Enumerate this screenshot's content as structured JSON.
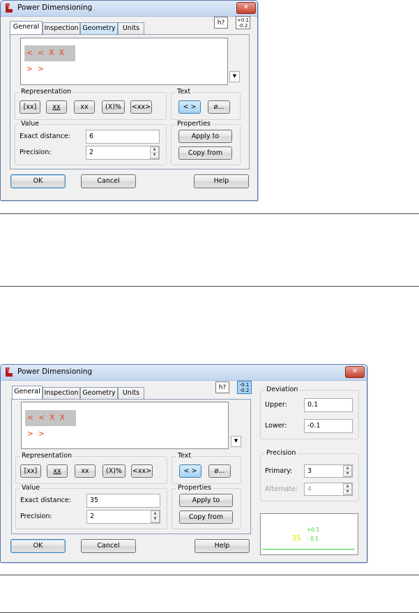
{
  "dialog_top": {
    "title": "Power Dimensioning",
    "close_glyph": "✕",
    "tabs": [
      {
        "label": "General",
        "state": "active"
      },
      {
        "label": "Inspection",
        "state": "normal"
      },
      {
        "label": "Geometry",
        "state": "hover"
      },
      {
        "label": "Units",
        "state": "normal"
      }
    ],
    "h_icon": "h?",
    "tol_icon_top": "+0.1",
    "tol_icon_bottom": "-0.2",
    "dimension_text": "< < X X > >",
    "representation": {
      "label": "Representation",
      "buttons": [
        "[xx]",
        "xx",
        "xx",
        "(X)%",
        "<xx>"
      ]
    },
    "text_group": {
      "label": "Text",
      "buttons": [
        "< >",
        "ø..."
      ]
    },
    "value": {
      "label": "Value",
      "exact_label": "Exact distance:",
      "exact_value": "6",
      "precision_label": "Precision:",
      "precision_value": "2"
    },
    "properties": {
      "label": "Properties",
      "apply": "Apply to",
      "copy": "Copy from"
    },
    "ok": "OK",
    "cancel": "Cancel",
    "help": "Help"
  },
  "dialog_bottom": {
    "title": "Power Dimensioning",
    "close_glyph": "✕",
    "tabs": [
      {
        "label": "General",
        "state": "active"
      },
      {
        "label": "Inspection",
        "state": "normal"
      },
      {
        "label": "Geometry",
        "state": "normal"
      },
      {
        "label": "Units",
        "state": "normal"
      }
    ],
    "h_icon": "h?",
    "tol_icon_top": "-0.1",
    "tol_icon_bottom": "-0.2",
    "dimension_text": "< < X X > >",
    "representation": {
      "label": "Representation",
      "buttons": [
        "[xx]",
        "xx",
        "xx",
        "(X)%",
        "<xx>"
      ]
    },
    "text_group": {
      "label": "Text",
      "buttons": [
        "< >",
        "ø..."
      ]
    },
    "value": {
      "label": "Value",
      "exact_label": "Exact distance:",
      "exact_value": "35",
      "precision_label": "Precision:",
      "precision_value": "2"
    },
    "properties": {
      "label": "Properties",
      "apply": "Apply to",
      "copy": "Copy from"
    },
    "deviation": {
      "label": "Deviation",
      "upper_label": "Upper:",
      "upper_value": "0.1",
      "lower_label": "Lower:",
      "lower_value": "-0.1"
    },
    "precision": {
      "label": "Precision",
      "primary_label": "Primary:",
      "primary_value": "3",
      "alternate_label": "Alternate:",
      "alternate_value": "4"
    },
    "preview": {
      "main": "35",
      "upper": "+0.1",
      "lower": "- 0.1"
    },
    "ok": "OK",
    "cancel": "Cancel",
    "help": "Help"
  },
  "colors": {
    "accent_red": "#e8431e",
    "preview_yellow": "#e6e600",
    "preview_green": "#33cc33"
  }
}
